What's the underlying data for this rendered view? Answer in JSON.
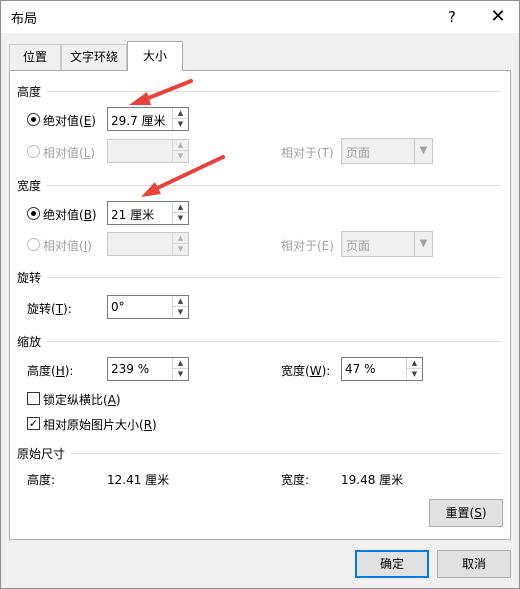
{
  "title": "布局",
  "help": "?",
  "close": "✕",
  "tabs": [
    "位置",
    "文字环绕",
    "大小"
  ],
  "sections": {
    "height": "高度",
    "width": "宽度",
    "rotate": "旋转",
    "scale": "缩放",
    "original": "原始尺寸"
  },
  "height": {
    "abs_label": "绝对值(",
    "abs_key": "E",
    "abs_value": "29.7 厘米",
    "rel_label": "相对值(",
    "rel_key": "L",
    "rel_to_label": "相对于(T)",
    "rel_to_value": "页面"
  },
  "width": {
    "abs_label": "绝对值(",
    "abs_key": "B",
    "abs_value": "21 厘米",
    "rel_label": "相对值(",
    "rel_key": "I",
    "rel_to_label": "相对于(E)",
    "rel_to_value": "页面"
  },
  "rotate": {
    "label": "旋转(",
    "key": "T",
    "value": "0°"
  },
  "scale": {
    "height_label": "高度(",
    "height_key": "H",
    "height_value": "239 %",
    "width_label": "宽度(",
    "width_key": "W",
    "width_value": "47 %",
    "lock_label": "锁定纵横比(",
    "lock_key": "A",
    "lock_checked": false,
    "relative_label": "相对原始图片大小(",
    "relative_key": "R",
    "relative_checked": true
  },
  "original": {
    "height_label": "高度:",
    "height_value": "12.41 厘米",
    "width_label": "宽度:",
    "width_value": "19.48 厘米"
  },
  "buttons": {
    "reset_label": "重置(",
    "reset_key": "S",
    "ok": "确定",
    "cancel": "取消"
  },
  "close_paren": ")",
  "colon_paren": "):",
  "annotation_color": "#e8423a",
  "accent_color": "#0078d7"
}
